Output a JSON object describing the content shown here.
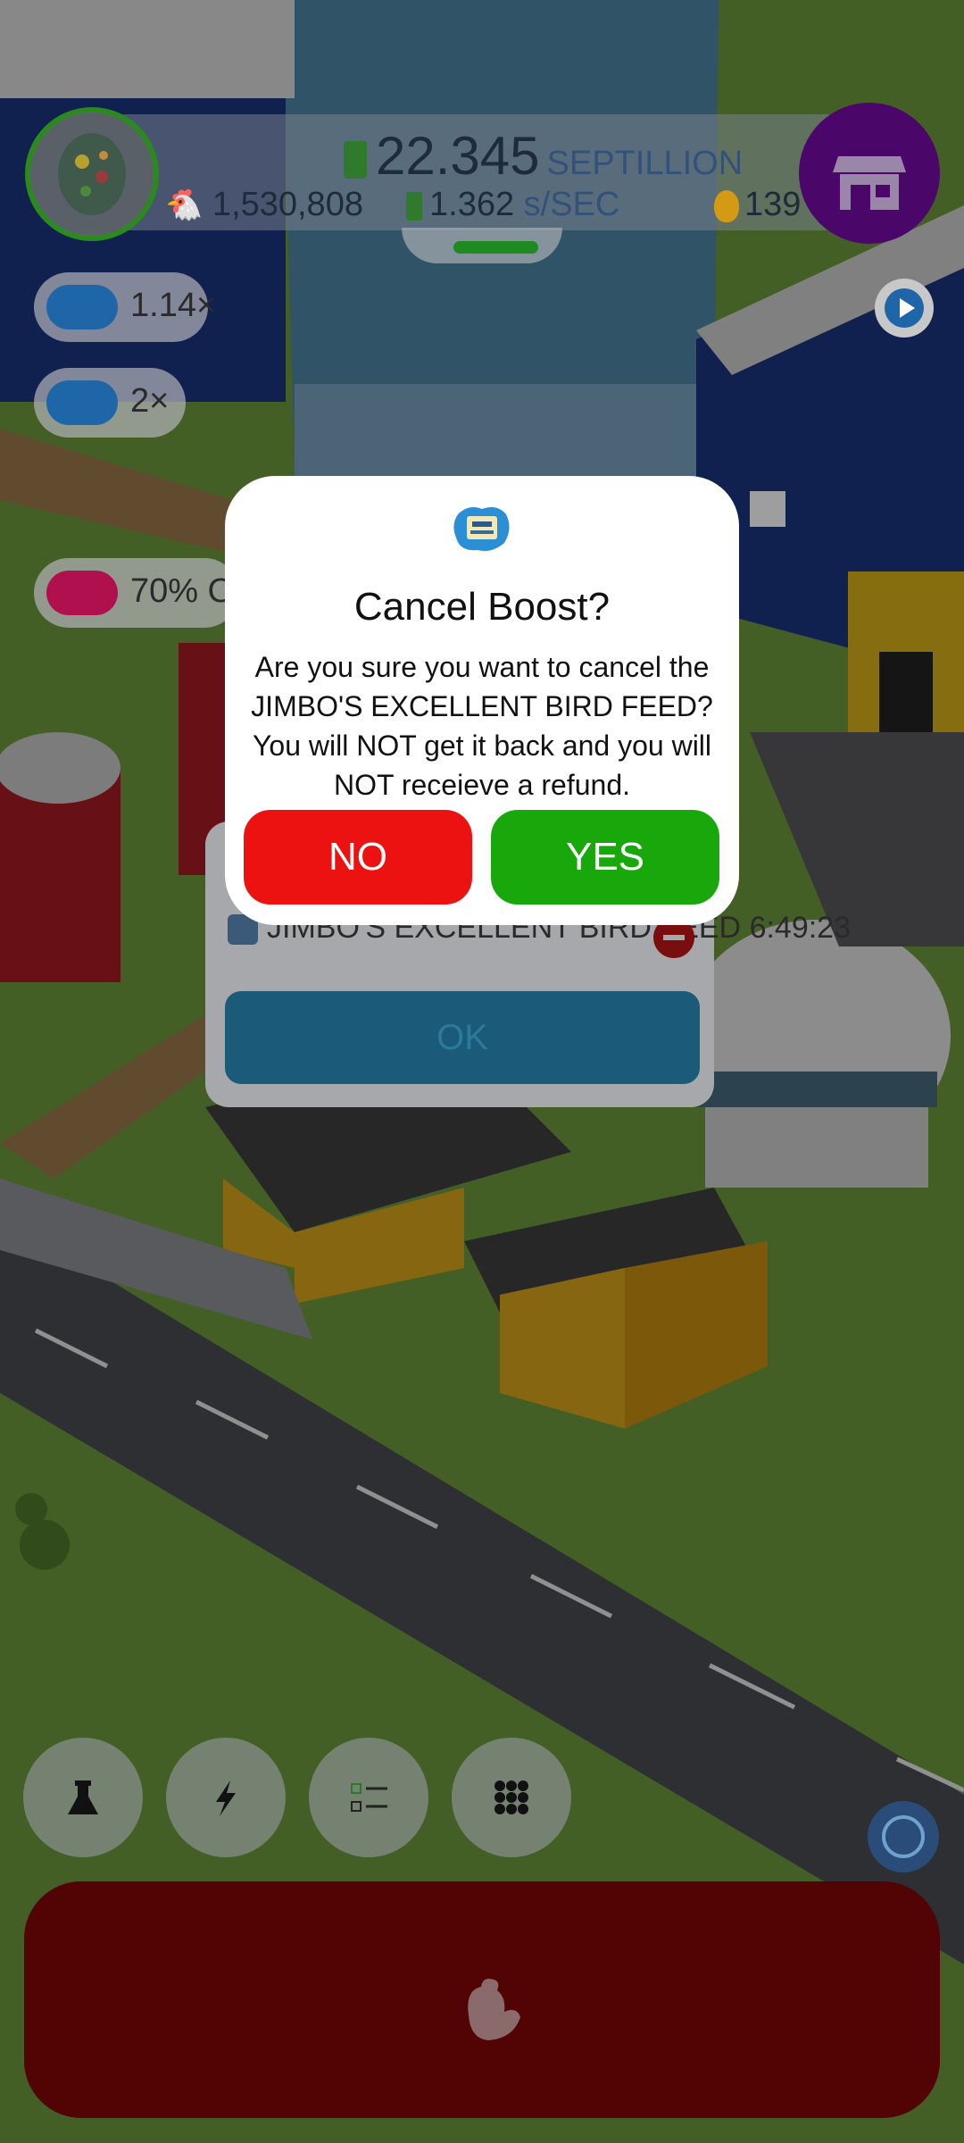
{
  "hud": {
    "money_value": "22.345",
    "money_unit": "SEPTILLION",
    "chicken_count": "1,530,808",
    "rate_value": "1.362",
    "rate_unit": "s/SEC",
    "egg_count": "139",
    "farm_progress": 0.85
  },
  "boosts": {
    "chicken_multiplier": "1.14×",
    "video_multiplier": "2×",
    "sale_label": "70% OF"
  },
  "underlying_dialog": {
    "boost_name": "JIMBO'S EXCELLENT BIRD FEED",
    "time_left": "6:49:23",
    "ok_label": "OK"
  },
  "dialog": {
    "title": "Cancel Boost?",
    "body": "Are you sure you want to cancel the JIMBO'S EXCELLENT BIRD FEED? You will NOT get it back and you will NOT receieve a refund.",
    "no_label": "NO",
    "yes_label": "YES"
  },
  "icons": {
    "shop": "shop-icon",
    "research": "flask-icon",
    "boost": "lightning-icon",
    "missions": "checklist-icon",
    "menu": "grid-icon",
    "hatch": "chicken-icon",
    "camera": "circle-icon"
  },
  "colors": {
    "no_button": "#ec1212",
    "yes_button": "#19a80c",
    "hatch_button": "#520404",
    "shop_button": "#4a0769"
  }
}
